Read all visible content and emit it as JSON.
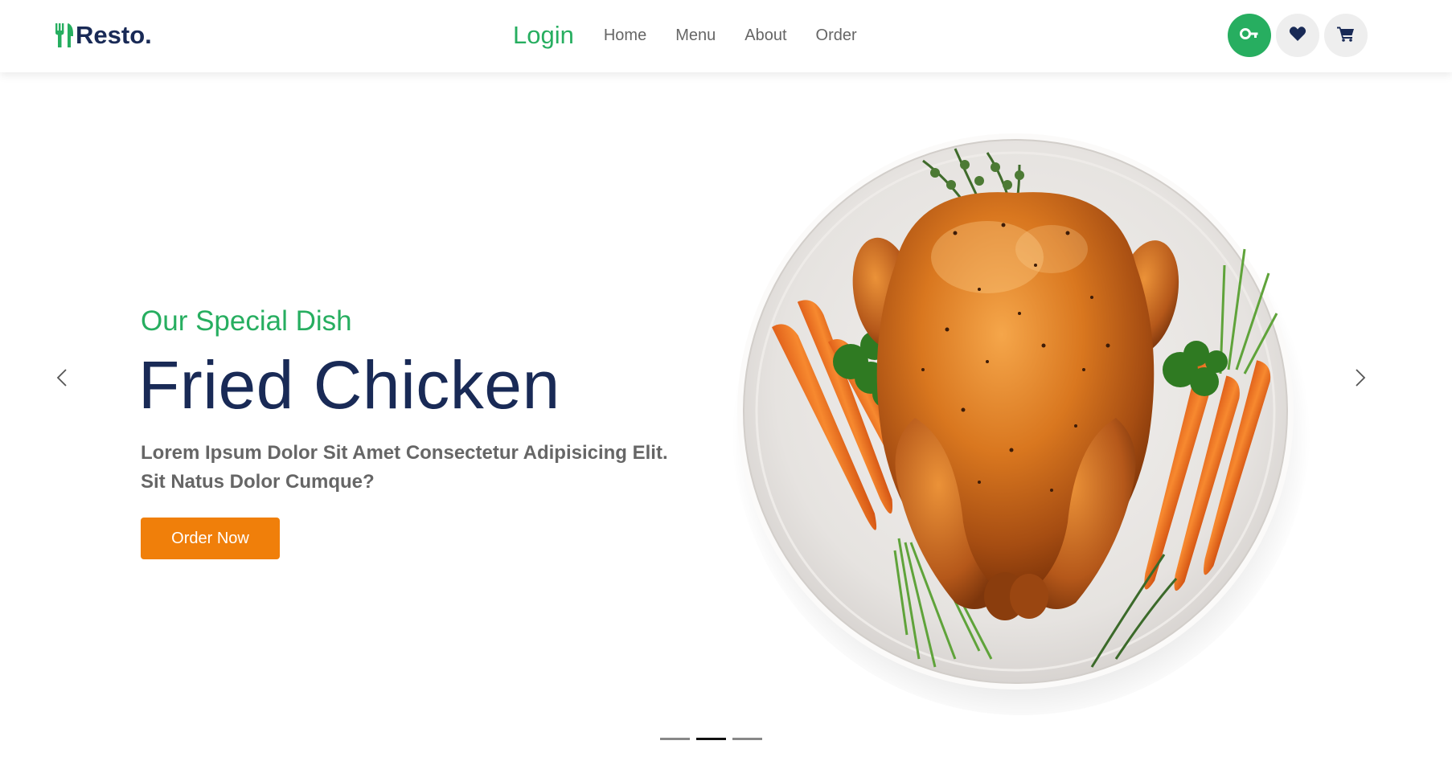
{
  "brand": {
    "name": "Resto.",
    "logo_icon": "utensils-icon",
    "color": "#192a56",
    "accent": "#27ae60"
  },
  "nav": {
    "login": "Login",
    "links": [
      "Home",
      "Menu",
      "About",
      "Order"
    ]
  },
  "header_icons": [
    {
      "name": "key-icon",
      "active": true
    },
    {
      "name": "heart-icon",
      "active": false
    },
    {
      "name": "cart-icon",
      "active": false
    }
  ],
  "hero": {
    "subtitle": "Our Special Dish",
    "title": "Fried Chicken",
    "description_line1": "Lorem Ipsum Dolor Sit Amet Consectetur Adipisicing Elit.",
    "description_line2": "Sit Natus Dolor Cumque?",
    "cta": "Order Now",
    "cta_color": "#f07f0a",
    "image": "roast-chicken-on-plate"
  },
  "carousel": {
    "slides": 3,
    "active": 2,
    "prev_icon": "chevron-left-icon",
    "next_icon": "chevron-right-icon"
  }
}
